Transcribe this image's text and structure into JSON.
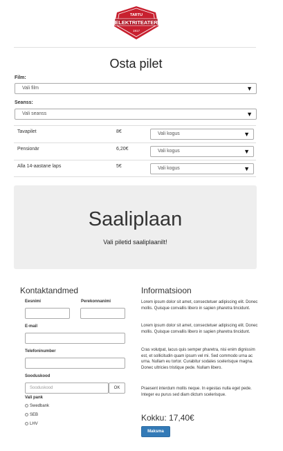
{
  "header": {
    "logo": {
      "top": "TARTU",
      "main": "ELEKTRITEATER",
      "since": "1917",
      "color": "#c8202f"
    }
  },
  "page": {
    "title": "Osta pilet"
  },
  "film": {
    "label": "Film:",
    "selected": "Vali film"
  },
  "session": {
    "label": "Seanss:",
    "selected": "Vali seanss"
  },
  "tickets": [
    {
      "name": "Tavapilet",
      "price": "8€",
      "quantity": "Vali kogus"
    },
    {
      "name": "Pensionär",
      "price": "6,20€",
      "quantity": "Vali kogus"
    },
    {
      "name": "Alla 14-aastane laps",
      "price": "5€",
      "quantity": "Vali kogus"
    }
  ],
  "hall": {
    "title": "Saaliplaan",
    "subtitle": "Vali piletid saaliplaanilt!"
  },
  "contact": {
    "heading": "Kontaktandmed",
    "first_name": "Eesnimi",
    "last_name": "Perekonnanimi",
    "email": "E-mail",
    "phone": "Telefoninumber",
    "discount_label": "Sooduskood",
    "discount_placeholder": "Sooduskood",
    "ok": "OK",
    "bank_label": "Vali pank",
    "banks": [
      "Swedbank",
      "SEB",
      "LHV"
    ]
  },
  "info": {
    "heading": "Informatsioon",
    "paragraphs": [
      "Lorem ipsum dolor sit amet, consectetuer adipiscing elit. Donec mollis. Quisque convallis libero in sapien pharetra tincidunt.",
      "Lorem ipsum dolor sit amet, consectetuer adipiscing elit. Donec mollis. Quisque convallis libero in sapien pharetra tincidunt.",
      "Cras volutpat, lacus quis semper pharetra, nisi enim dignissim est, et sollicitudin quam ipsum vel mi. Sed commodo urna ac urna. Nullam eu tortor. Curabitur sodales scelerisque magna. Donec ultricies tristique pede. Nullam libero.",
      "Praesent interdum mollis neque. In egestas nulla eget pede. Integer eu purus sed diam dictum scelerisque."
    ],
    "total": "Kokku: 17,40€",
    "pay": "Maksma",
    "pay_color": "#337ab7"
  }
}
